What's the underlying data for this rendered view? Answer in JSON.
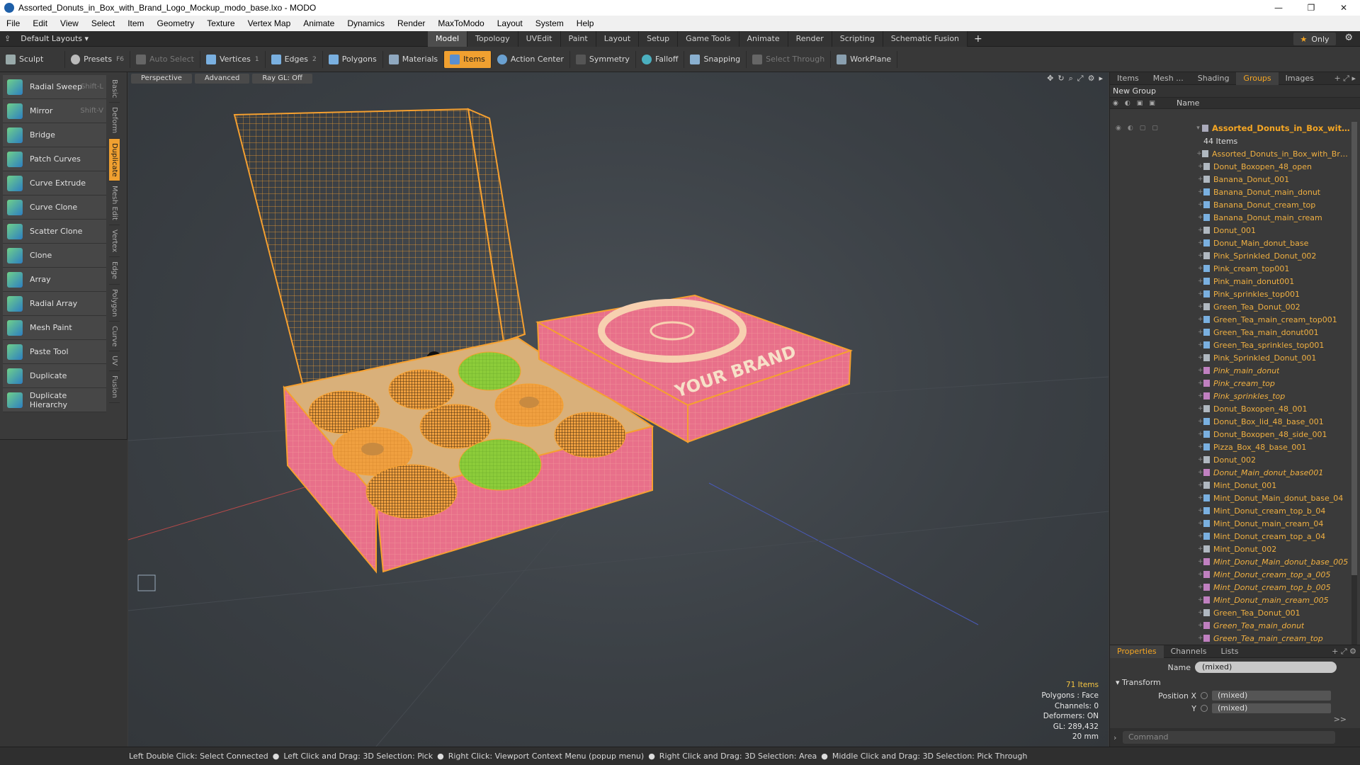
{
  "window": {
    "title": "Assorted_Donuts_in_Box_with_Brand_Logo_Mockup_modo_base.lxo - MODO",
    "controls": [
      "—",
      "❐",
      "✕"
    ]
  },
  "menu": [
    "File",
    "Edit",
    "View",
    "Select",
    "Item",
    "Geometry",
    "Texture",
    "Vertex Map",
    "Animate",
    "Dynamics",
    "Render",
    "MaxToModo",
    "Layout",
    "System",
    "Help"
  ],
  "layouts": {
    "label": "Default Layouts ▾"
  },
  "tabs": [
    "Model",
    "Topology",
    "UVEdit",
    "Paint",
    "Layout",
    "Setup",
    "Game Tools",
    "Animate",
    "Render",
    "Scripting",
    "Schematic Fusion"
  ],
  "active_tab": "Model",
  "only_label": "Only",
  "toolbar": {
    "sculpt": "Sculpt",
    "presets": "Presets",
    "presets_key": "F6",
    "auto_select": "Auto Select",
    "vertices": "Vertices",
    "vertices_count": "1",
    "edges": "Edges",
    "edges_count": "2",
    "polygons": "Polygons",
    "materials": "Materials",
    "items": "Items",
    "action_center": "Action Center",
    "symmetry": "Symmetry",
    "falloff": "Falloff",
    "snapping": "Snapping",
    "select_through": "Select Through",
    "workplane": "WorkPlane"
  },
  "tools": [
    {
      "label": "Radial Sweep",
      "shortcut": "Shift-L"
    },
    {
      "label": "Mirror",
      "shortcut": "Shift-V"
    },
    {
      "label": "Bridge",
      "shortcut": ""
    },
    {
      "label": "Patch Curves",
      "shortcut": ""
    },
    {
      "label": "Curve Extrude",
      "shortcut": ""
    },
    {
      "label": "Curve Clone",
      "shortcut": ""
    },
    {
      "label": "Scatter Clone",
      "shortcut": ""
    },
    {
      "label": "Clone",
      "shortcut": ""
    },
    {
      "label": "Array",
      "shortcut": ""
    },
    {
      "label": "Radial Array",
      "shortcut": ""
    },
    {
      "label": "Mesh Paint",
      "shortcut": ""
    },
    {
      "label": "Paste Tool",
      "shortcut": ""
    },
    {
      "label": "Duplicate",
      "shortcut": ""
    },
    {
      "label": "Duplicate Hierarchy",
      "shortcut": ""
    }
  ],
  "vertical_tabs": [
    "Basic",
    "Deform",
    "Duplicate",
    "Mesh Edit",
    "Vertex",
    "Edge",
    "Polygon",
    "Curve",
    "UV",
    "Fusion"
  ],
  "active_vertical_tab": "Duplicate",
  "viewport": {
    "perspective": "Perspective",
    "advanced": "Advanced",
    "raygl": "Ray GL: Off",
    "box_text": "YOUR BRAND",
    "stats": {
      "items": "71 Items",
      "polygons": "Polygons : Face",
      "channels": "Channels: 0",
      "deformers": "Deformers: ON",
      "gl": "GL: 289,432",
      "scale": "20 mm"
    }
  },
  "status": {
    "parts": [
      "Left Double Click: Select Connected",
      "Left Click and Drag: 3D Selection: Pick",
      "Right Click: Viewport Context Menu (popup menu)",
      "Right Click and Drag: 3D Selection: Area",
      "Middle Click and Drag: 3D Selection: Pick Through"
    ],
    "dot": "●"
  },
  "right_panel": {
    "tabs": [
      "Items",
      "Mesh ...",
      "Shading",
      "Groups",
      "Images"
    ],
    "active_tab": "Groups",
    "new_group": "New Group",
    "col_name": "Name",
    "root_name": "Assorted_Donuts_in_Box_with_Br...",
    "root_sub": "44 Items",
    "items": [
      {
        "name": "Assorted_Donuts_in_Box_with_Brand...",
        "type": "locator",
        "italic": false
      },
      {
        "name": "Donut_Boxopen_48_open",
        "type": "locator",
        "italic": false
      },
      {
        "name": "Banana_Donut_001",
        "type": "locator",
        "italic": false
      },
      {
        "name": "Banana_Donut_main_donut",
        "type": "mesh",
        "italic": false
      },
      {
        "name": "Banana_Donut_cream_top",
        "type": "mesh",
        "italic": false
      },
      {
        "name": "Banana_Donut_main_cream",
        "type": "mesh",
        "italic": false
      },
      {
        "name": "Donut_001",
        "type": "locator",
        "italic": false
      },
      {
        "name": "Donut_Main_donut_base",
        "type": "mesh",
        "italic": false
      },
      {
        "name": "Pink_Sprinkled_Donut_002",
        "type": "locator",
        "italic": false
      },
      {
        "name": "Pink_cream_top001",
        "type": "mesh",
        "italic": false
      },
      {
        "name": "Pink_main_donut001",
        "type": "mesh",
        "italic": false
      },
      {
        "name": "Pink_sprinkles_top001",
        "type": "mesh",
        "italic": false
      },
      {
        "name": "Green_Tea_Donut_002",
        "type": "locator",
        "italic": false
      },
      {
        "name": "Green_Tea_main_cream_top001",
        "type": "mesh",
        "italic": false
      },
      {
        "name": "Green_Tea_main_donut001",
        "type": "mesh",
        "italic": false
      },
      {
        "name": "Green_Tea_sprinkles_top001",
        "type": "mesh",
        "italic": false
      },
      {
        "name": "Pink_Sprinkled_Donut_001",
        "type": "locator",
        "italic": false
      },
      {
        "name": "Pink_main_donut",
        "type": "instance",
        "italic": true
      },
      {
        "name": "Pink_cream_top",
        "type": "instance",
        "italic": true
      },
      {
        "name": "Pink_sprinkles_top",
        "type": "instance",
        "italic": true
      },
      {
        "name": "Donut_Boxopen_48_001",
        "type": "locator",
        "italic": false
      },
      {
        "name": "Donut_Box_lid_48_base_001",
        "type": "mesh",
        "italic": false
      },
      {
        "name": "Donut_Boxopen_48_side_001",
        "type": "mesh",
        "italic": false
      },
      {
        "name": "Pizza_Box_48_base_001",
        "type": "mesh",
        "italic": false
      },
      {
        "name": "Donut_002",
        "type": "locator",
        "italic": false
      },
      {
        "name": "Donut_Main_donut_base001",
        "type": "instance",
        "italic": true
      },
      {
        "name": "Mint_Donut_001",
        "type": "locator",
        "italic": false
      },
      {
        "name": "Mint_Donut_Main_donut_base_04",
        "type": "mesh",
        "italic": false
      },
      {
        "name": "Mint_Donut_cream_top_b_04",
        "type": "mesh",
        "italic": false
      },
      {
        "name": "Mint_Donut_main_cream_04",
        "type": "mesh",
        "italic": false
      },
      {
        "name": "Mint_Donut_cream_top_a_04",
        "type": "mesh",
        "italic": false
      },
      {
        "name": "Mint_Donut_002",
        "type": "locator",
        "italic": false
      },
      {
        "name": "Mint_Donut_Main_donut_base_005",
        "type": "instance",
        "italic": true
      },
      {
        "name": "Mint_Donut_cream_top_a_005",
        "type": "instance",
        "italic": true
      },
      {
        "name": "Mint_Donut_cream_top_b_005",
        "type": "instance",
        "italic": true
      },
      {
        "name": "Mint_Donut_main_cream_005",
        "type": "instance",
        "italic": true
      },
      {
        "name": "Green_Tea_Donut_001",
        "type": "locator",
        "italic": false
      },
      {
        "name": "Green_Tea_main_donut",
        "type": "instance",
        "italic": true
      },
      {
        "name": "Green_Tea_main_cream_top",
        "type": "instance",
        "italic": true
      }
    ]
  },
  "properties": {
    "tabs": [
      "Properties",
      "Channels",
      "Lists"
    ],
    "active_tab": "Properties",
    "name_label": "Name",
    "name_value": "(mixed)",
    "transform": "Transform",
    "position_x_label": "Position X",
    "position_x": "(mixed)",
    "y_label": "Y",
    "y_value": "(mixed)",
    "expand": ">>",
    "command_placeholder": "Command"
  },
  "colors": {
    "accent": "#f0a030",
    "wire": "#f5a030",
    "box_pink": "#e8708a",
    "icing_green": "#8ccc3a",
    "donut_orange": "#f0a040"
  }
}
